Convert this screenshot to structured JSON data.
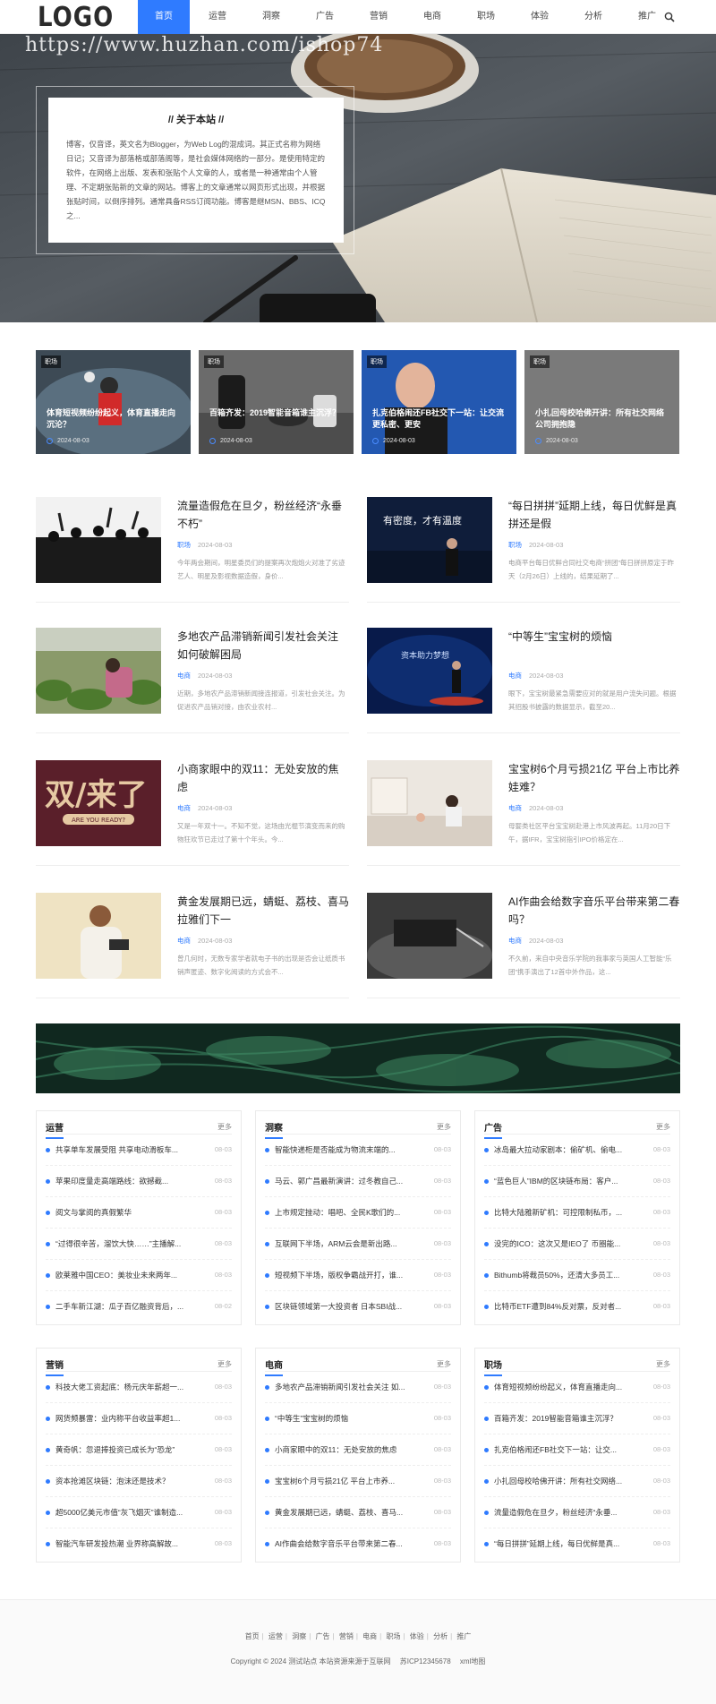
{
  "nav": {
    "logo": "LOGO",
    "items": [
      "首页",
      "运营",
      "洞察",
      "广告",
      "营销",
      "电商",
      "职场",
      "体验",
      "分析",
      "推广"
    ]
  },
  "hero": {
    "watermark": "https://www.huzhan.com/ishop74",
    "about_title": "// 关于本站 //",
    "about_text": "博客，仅音译，英文名为Blogger，为Web Log的混成词。其正式名称为网络日记；又音译为部落格或部落阁等，是社会媒体网络的一部分。是使用特定的软件，在网络上出版、发表和张贴个人文章的人，或者是一种通常由个人管理、不定期张贴新的文章的网站。博客上的文章通常以网页形式出现，并根据张贴时间，以倒序排列。通常具备RSS订阅功能。博客是继MSN、BBS、ICQ之..."
  },
  "featured": [
    {
      "tag": "职场",
      "title": "体育短视频纷纷起义，体育直播走向沉沦？",
      "date": "2024-08-03"
    },
    {
      "tag": "职场",
      "title": "百箱齐发：2019智能音箱谁主沉浮？",
      "date": "2024-08-03"
    },
    {
      "tag": "职场",
      "title": "扎克伯格闹还FB社交下一站：让交流更私密、更安",
      "date": "2024-08-03"
    },
    {
      "tag": "职场",
      "title": "小扎回母校哈佛开讲：所有社交网络公司拥抱隐",
      "date": "2024-08-03"
    }
  ],
  "articles": [
    {
      "title": "流量造假危在旦夕，粉丝经济“永垂不朽”",
      "cat": "职场",
      "date": "2024-08-03",
      "excerpt": "今年两会期间，明星委员们的提案再次炮炮火对准了劣迹艺人、明星及影视数据造假，身价..."
    },
    {
      "title": "“每日拼拼”延期上线，每日优鲜是真拼还是假",
      "cat": "职场",
      "date": "2024-08-03",
      "excerpt": "电商平台每日优鲜合同社交电商“拼团”每日拼拼原定于昨天（2月26日）上线的，结果延期了..."
    },
    {
      "title": "多地农产品滞销新闻引发社会关注 如何破解困局",
      "cat": "电商",
      "date": "2024-08-03",
      "excerpt": "近期，多地农产品滞销新闻接连报道，引发社会关注。为促进农产品销对接，由农业农村..."
    },
    {
      "title": "“中等生”宝宝树的烦恼",
      "cat": "电商",
      "date": "2024-08-03",
      "excerpt": "眼下，宝宝树最紧急需要应对的就是用户流失问题。根据其招股书披露的数据显示，截至20..."
    },
    {
      "title": "小商家眼中的双11：无处安放的焦虑",
      "cat": "电商",
      "date": "2024-08-03",
      "excerpt": "又是一年双十一。不知不觉，这场由光棍节演变而来的购物狂欢节已走过了第十个年头。今..."
    },
    {
      "title": "宝宝树6个月亏损21亿 平台上市比养娃难？",
      "cat": "电商",
      "date": "2024-08-03",
      "excerpt": "母婴类社区平台宝宝树赴港上市风波再起。11月20日下午，据IFR，宝宝树指引IPO价格定在..."
    },
    {
      "title": "黄金发展期已远，蜻蜓、荔枝、喜马拉雅们下一",
      "cat": "电商",
      "date": "2024-08-03",
      "excerpt": "曾几何时，无数专家学者就电子书的出现是否会让纸质书销声匿迹、数字化阅读的方式会不..."
    },
    {
      "title": "AI作曲会给数字音乐平台带来第二春吗？",
      "cat": "电商",
      "date": "2024-08-03",
      "excerpt": "不久前，来自中央音乐学院的我事家与英国人工智能“乐团”携手演出了12首中外作品，这..."
    }
  ],
  "categories": [
    {
      "name": "运营",
      "more": "更多",
      "items": [
        {
          "t": "共享单车发展受阻 共享电动滑板车...",
          "d": "08-03"
        },
        {
          "t": "苹果印度量走高端路线：欲撼截...",
          "d": "08-03"
        },
        {
          "t": "阅文与掌阅的真假繁华",
          "d": "08-03"
        },
        {
          "t": "“过得很辛苦，溜饮大快……”主播解...",
          "d": "08-03"
        },
        {
          "t": "欧莱雅中国CEO：美妆业未来两年...",
          "d": "08-03"
        },
        {
          "t": "二手车新江湖：瓜子百亿融资背后，...",
          "d": "08-02"
        }
      ]
    },
    {
      "name": "洞察",
      "more": "更多",
      "items": [
        {
          "t": "智能快递柜是否能成为物流末端的...",
          "d": "08-03"
        },
        {
          "t": "马云、郭广昌最新演讲：过冬教自己...",
          "d": "08-03"
        },
        {
          "t": "上市规定挫动：唱吧、全民K歌们的...",
          "d": "08-03"
        },
        {
          "t": "互联网下半场，ARM云会是新出路...",
          "d": "08-03"
        },
        {
          "t": "短视频下半场，版权争霸战开打，谁...",
          "d": "08-03"
        },
        {
          "t": "区块链领域第一大投资者 日本SBI战...",
          "d": "08-03"
        }
      ]
    },
    {
      "name": "广告",
      "more": "更多",
      "items": [
        {
          "t": "冰岛最大拉动家剧本：偷矿机、偷电...",
          "d": "08-03"
        },
        {
          "t": "“蓝色巨人”IBM的区块链布局：客户...",
          "d": "08-03"
        },
        {
          "t": "比特大陆雅新矿机：可控限制私币，...",
          "d": "08-03"
        },
        {
          "t": "没完的ICO：这次又是IEO了 币圈能...",
          "d": "08-03"
        },
        {
          "t": "Bithumb将裁员50%，还清大多员工...",
          "d": "08-03"
        },
        {
          "t": "比特币ETF遭到84%反对票，反对者...",
          "d": "08-03"
        }
      ]
    },
    {
      "name": "营销",
      "more": "更多",
      "items": [
        {
          "t": "科技大佬工资起底：杨元庆年薪超一...",
          "d": "08-03"
        },
        {
          "t": "网货频暴雷：业内称平台收益率超1...",
          "d": "08-03"
        },
        {
          "t": "黄奇帆：忽退捧投资已成长为“恐龙”",
          "d": "08-03"
        },
        {
          "t": "资本抢滩区块链：泡沫还是技术？",
          "d": "08-03"
        },
        {
          "t": "超5000亿美元市值“灰飞烟灭”谁制造...",
          "d": "08-03"
        },
        {
          "t": "智能汽车研发投热潮 业界称高解故...",
          "d": "08-03"
        }
      ]
    },
    {
      "name": "电商",
      "more": "更多",
      "items": [
        {
          "t": "多地农产品滞销新闻引发社会关注 如...",
          "d": "08-03"
        },
        {
          "t": "“中等生”宝宝树的烦恼",
          "d": "08-03"
        },
        {
          "t": "小商家眼中的双11：无处安放的焦虑",
          "d": "08-03"
        },
        {
          "t": "宝宝树6个月亏损21亿 平台上市养...",
          "d": "08-03"
        },
        {
          "t": "黄金发展期已远，蜻蜓、荔枝、喜马...",
          "d": "08-03"
        },
        {
          "t": "AI作曲会给数字音乐平台带来第二春...",
          "d": "08-03"
        }
      ]
    },
    {
      "name": "职场",
      "more": "更多",
      "items": [
        {
          "t": "体育短视频纷纷起义，体育直播走向...",
          "d": "08-03"
        },
        {
          "t": "百箱齐发：2019智能音箱谁主沉浮？",
          "d": "08-03"
        },
        {
          "t": "扎克伯格闹还FB社交下一站：让交...",
          "d": "08-03"
        },
        {
          "t": "小扎回母校哈佛开讲：所有社交网络...",
          "d": "08-03"
        },
        {
          "t": "流量造假危在旦夕，粉丝经济“永垂...",
          "d": "08-03"
        },
        {
          "t": "“每日拼拼”延期上线，每日优鲜是真...",
          "d": "08-03"
        }
      ]
    }
  ],
  "footer": {
    "links": [
      "首页",
      "运营",
      "洞察",
      "广告",
      "营销",
      "电商",
      "职场",
      "体验",
      "分析",
      "推广"
    ],
    "copyright": "Copyright © 2024 测试站点 本站资源来源于互联网",
    "icp": "苏ICP12345678",
    "sitemap": "xml地图"
  },
  "colors": {
    "accent": "#2f7bff",
    "text": "#222222",
    "muted": "#999999"
  }
}
